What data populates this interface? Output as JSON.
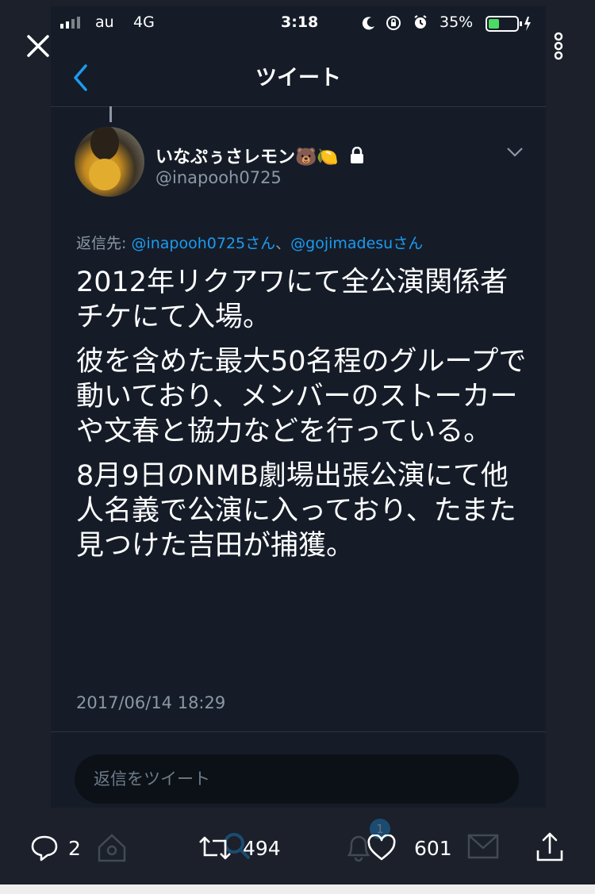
{
  "status_bar": {
    "carrier": "au",
    "network": "4G",
    "time": "3:18",
    "battery": "35%"
  },
  "nav": {
    "title": "ツイート"
  },
  "tweet": {
    "display_name": "いなぷぅさレモン🐻🍋",
    "username": "@inapooh0725",
    "reply_prefix": "返信先:",
    "reply_mention_1": "@inapooh0725さん",
    "reply_separator": "、",
    "reply_mention_2": "@gojimadesuさん",
    "paragraphs": [
      "2012年リクアワにて全公演関係者チケにて入場。",
      "彼を含めた最大50名程のグループで動いており、メンバーのストーカーや文春と協力などを行っている。",
      "8月9日のNMB劇場出張公演にて他人名義で公演に入っており、たまた見つけた吉田が捕獲。"
    ],
    "timestamp": "2017/06/14 18:29"
  },
  "reply_box": {
    "placeholder": "返信をツイート"
  },
  "actions": {
    "reply_count": "2",
    "retweet_count": "494",
    "like_count": "601",
    "notification_badge": "1"
  },
  "colors": {
    "background": "#1b202b",
    "panel": "#151c28",
    "accent": "#1d9bf0",
    "secondary_text": "#8b98a5"
  }
}
